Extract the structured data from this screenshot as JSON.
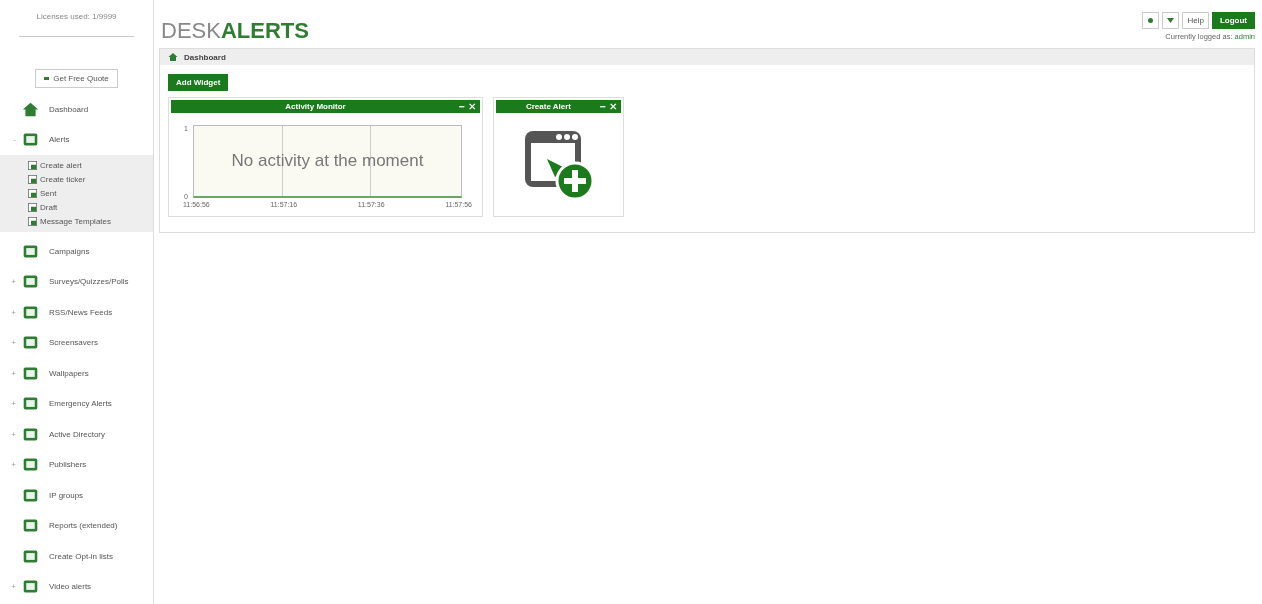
{
  "sidebar": {
    "licenses": "Licenses used: 1/9999",
    "quote_button": "Get Free Quote",
    "items": [
      {
        "label": "Dashboard"
      },
      {
        "label": "Alerts",
        "toggle": "-",
        "children": [
          {
            "label": "Create alert"
          },
          {
            "label": "Create ticker"
          },
          {
            "label": "Sent"
          },
          {
            "label": "Draft"
          },
          {
            "label": "Message Templates"
          }
        ]
      },
      {
        "label": "Campaigns"
      },
      {
        "label": "Surveys/Quizzes/Polls",
        "toggle": "+"
      },
      {
        "label": "RSS/News Feeds",
        "toggle": "+"
      },
      {
        "label": "Screensavers",
        "toggle": "+"
      },
      {
        "label": "Wallpapers",
        "toggle": "+"
      },
      {
        "label": "Emergency Alerts",
        "toggle": "+"
      },
      {
        "label": "Active Directory",
        "toggle": "+"
      },
      {
        "label": "Publishers",
        "toggle": "+"
      },
      {
        "label": "IP groups"
      },
      {
        "label": "Reports (extended)"
      },
      {
        "label": "Create Opt-in lists"
      },
      {
        "label": "Video alerts",
        "toggle": "+"
      }
    ]
  },
  "header": {
    "logo_plain": "DESK",
    "logo_bold": "ALERTS",
    "help": "Help",
    "logout": "Logout",
    "logged_in": "Currently logged as:",
    "user": "admin"
  },
  "breadcrumb": "Dashboard",
  "add_widget": "Add Widget",
  "widgets": [
    {
      "kind": "activity",
      "title": "Activity Monitor",
      "message": "No activity at the moment",
      "y_labels": [
        "1",
        "0"
      ],
      "x_labels": [
        "11:56:56",
        "11:57:16",
        "11:57:36",
        "11:57:56"
      ]
    },
    {
      "kind": "create",
      "title": "Create Alert"
    }
  ]
}
